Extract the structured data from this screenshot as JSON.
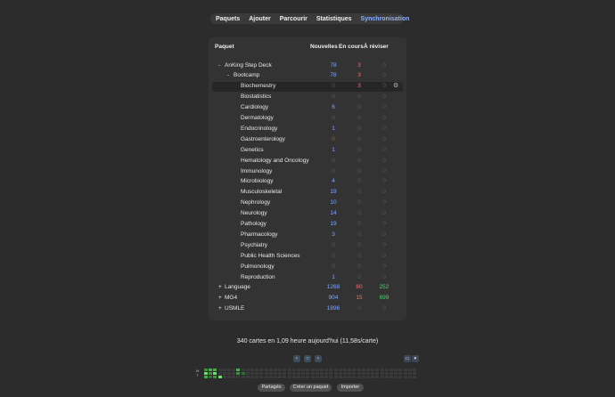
{
  "nav": {
    "decks": "Paquets",
    "add": "Ajouter",
    "browse": "Parcourir",
    "stats": "Statistiques",
    "sync": "Synchronisation"
  },
  "table": {
    "headers": {
      "deck": "Paquet",
      "new": "Nouvelles",
      "learn": "En cours",
      "review": "À réviser"
    },
    "rows": [
      {
        "toggle": "-",
        "name": "AnKing Step Deck",
        "level": 0,
        "new": "78",
        "learn": "3",
        "review": "0"
      },
      {
        "toggle": "-",
        "name": "Bootcamp",
        "level": 1,
        "new": "78",
        "learn": "3",
        "review": "0"
      },
      {
        "toggle": "",
        "name": "Biochemestry",
        "level": 2,
        "new": "0",
        "learn": "3",
        "review": "0",
        "selected": true
      },
      {
        "toggle": "",
        "name": "Biostatistics",
        "level": 2,
        "new": "0",
        "learn": "0",
        "review": "0"
      },
      {
        "toggle": "",
        "name": "Cardiology",
        "level": 2,
        "new": "6",
        "learn": "0",
        "review": "0"
      },
      {
        "toggle": "",
        "name": "Dermatology",
        "level": 2,
        "new": "0",
        "learn": "0",
        "review": "0"
      },
      {
        "toggle": "",
        "name": "Endocrinology",
        "level": 2,
        "new": "1",
        "learn": "0",
        "review": "0"
      },
      {
        "toggle": "",
        "name": "Gastroenterology",
        "level": 2,
        "new": "0",
        "learn": "0",
        "review": "0"
      },
      {
        "toggle": "",
        "name": "Genetics",
        "level": 2,
        "new": "1",
        "learn": "0",
        "review": "0"
      },
      {
        "toggle": "",
        "name": "Hematology and Oncology",
        "level": 2,
        "new": "0",
        "learn": "0",
        "review": "0"
      },
      {
        "toggle": "",
        "name": "Immunology",
        "level": 2,
        "new": "0",
        "learn": "0",
        "review": "0"
      },
      {
        "toggle": "",
        "name": "Microbiology",
        "level": 2,
        "new": "4",
        "learn": "0",
        "review": "0"
      },
      {
        "toggle": "",
        "name": "Musculoskeletal",
        "level": 2,
        "new": "19",
        "learn": "0",
        "review": "0"
      },
      {
        "toggle": "",
        "name": "Nephrology",
        "level": 2,
        "new": "10",
        "learn": "0",
        "review": "0"
      },
      {
        "toggle": "",
        "name": "Neurology",
        "level": 2,
        "new": "14",
        "learn": "0",
        "review": "0"
      },
      {
        "toggle": "",
        "name": "Pathology",
        "level": 2,
        "new": "19",
        "learn": "0",
        "review": "0"
      },
      {
        "toggle": "",
        "name": "Pharmacology",
        "level": 2,
        "new": "3",
        "learn": "0",
        "review": "0"
      },
      {
        "toggle": "",
        "name": "Psychiatry",
        "level": 2,
        "new": "0",
        "learn": "0",
        "review": "0"
      },
      {
        "toggle": "",
        "name": "Public Health Sciences",
        "level": 2,
        "new": "0",
        "learn": "0",
        "review": "0"
      },
      {
        "toggle": "",
        "name": "Pulmonology",
        "level": 2,
        "new": "0",
        "learn": "0",
        "review": "0"
      },
      {
        "toggle": "",
        "name": "Reproduction",
        "level": 2,
        "new": "1",
        "learn": "0",
        "review": "0"
      },
      {
        "toggle": "+",
        "name": "Language",
        "level": 0,
        "new": "1268",
        "learn": "60",
        "review": "252"
      },
      {
        "toggle": "+",
        "name": "MG4",
        "level": 0,
        "new": "904",
        "learn": "15",
        "review": "699"
      },
      {
        "toggle": "+",
        "name": "USMLE",
        "level": 0,
        "new": "1896",
        "learn": "0",
        "review": "0"
      }
    ]
  },
  "studied": "340 cartes en 1,09 heure aujourd'hui (11,58s/carte)",
  "heatmap_controls": {
    "prev": "‹",
    "today": "○",
    "next": "›"
  },
  "heatmap": {
    "day_labels": [
      "M",
      "T"
    ],
    "colors": {
      "empty": "#3a3a3a",
      "light": "#3f8f3f",
      "mid": "#45b045",
      "bright": "#6ee06e",
      "dark": "#2f6f2f"
    }
  },
  "bottom_buttons": {
    "shared": "Partagés",
    "create": "Créer un paquet",
    "import": "Importer"
  }
}
